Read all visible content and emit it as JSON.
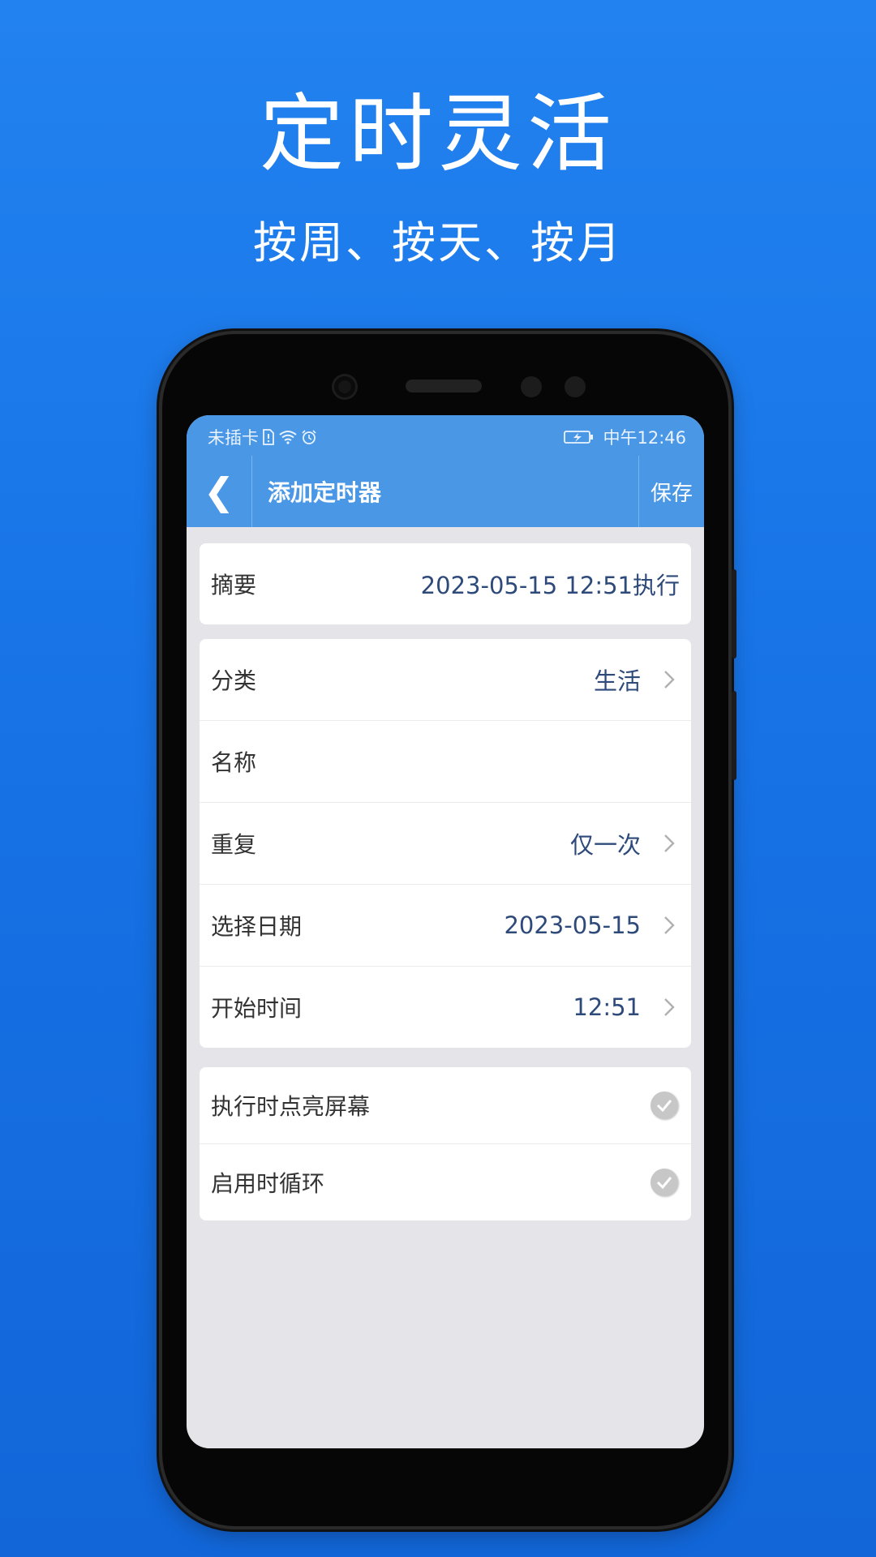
{
  "promo": {
    "title": "定时灵活",
    "subtitle": "按周、按天、按月"
  },
  "status_bar": {
    "carrier": "未插卡",
    "time": "中午12:46",
    "icons": [
      "sim-icon",
      "wifi-icon",
      "alarm-icon",
      "battery-charging-icon"
    ]
  },
  "navbar": {
    "back_label": "❮",
    "title": "添加定时器",
    "save_label": "保存"
  },
  "summary": {
    "label": "摘要",
    "value": "2023-05-15 12:51执行"
  },
  "settings": [
    {
      "label": "分类",
      "value": "生活"
    },
    {
      "label": "名称",
      "value": ""
    },
    {
      "label": "重复",
      "value": "仅一次"
    },
    {
      "label": "选择日期",
      "value": "2023-05-15"
    },
    {
      "label": "开始时间",
      "value": "12:51"
    }
  ],
  "toggles": [
    {
      "label": "执行时点亮屏幕",
      "checked": true
    },
    {
      "label": "启用时循环",
      "checked": true
    }
  ],
  "colors": {
    "background": "#1773e6",
    "header": "#4a97e6",
    "value_text": "#2d4a7a",
    "screen_bg": "#e5e4e9"
  }
}
